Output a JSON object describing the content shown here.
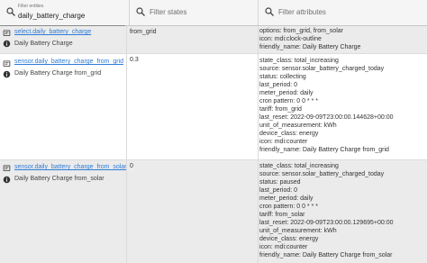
{
  "filters": {
    "entities": {
      "label": "Filter entities",
      "value": "daily_battery_charge"
    },
    "states": {
      "placeholder": "Filter states"
    },
    "attributes": {
      "placeholder": "Filter attributes"
    }
  },
  "rows": [
    {
      "entity_id": "select.daily_battery_charge",
      "name": "Daily Battery Charge",
      "state": "from_grid",
      "attributes": [
        "options: from_grid, from_solar",
        "icon: mdi:clock-outline",
        "friendly_name: Daily Battery Charge"
      ]
    },
    {
      "entity_id": "sensor.daily_battery_charge_from_grid",
      "name": "Daily Battery Charge from_grid",
      "state": "0.3",
      "attributes": [
        "state_class: total_increasing",
        "source: sensor.solar_battery_charged_today",
        "status: collecting",
        "last_period: 0",
        "meter_period: daily",
        "cron pattern: 0 0 * * *",
        "tariff: from_grid",
        "last_reset: 2022-09-09T23:00:00.144628+00:00",
        "unit_of_measurement: kWh",
        "device_class: energy",
        "icon: mdi:counter",
        "friendly_name: Daily Battery Charge from_grid"
      ]
    },
    {
      "entity_id": "sensor.daily_battery_charge_from_solar",
      "name": "Daily Battery Charge from_solar",
      "state": "0",
      "attributes": [
        "state_class: total_increasing",
        "source: sensor.solar_battery_charged_today",
        "status: paused",
        "last_period: 0",
        "meter_period: daily",
        "cron pattern: 0 0 * * *",
        "tariff: from_solar",
        "last_reset: 2022-09-09T23:00:00.129695+00:00",
        "unit_of_measurement: kWh",
        "device_class: energy",
        "icon: mdi:counter",
        "friendly_name: Daily Battery Charge from_solar"
      ]
    }
  ],
  "colors": {
    "link": "#2e7cd6",
    "alt_row": "#ebebeb",
    "filter_bar": "#f5f5f5"
  },
  "icons": {
    "search": "search-icon",
    "edit": "edit-entity-icon",
    "info": "info-icon"
  }
}
